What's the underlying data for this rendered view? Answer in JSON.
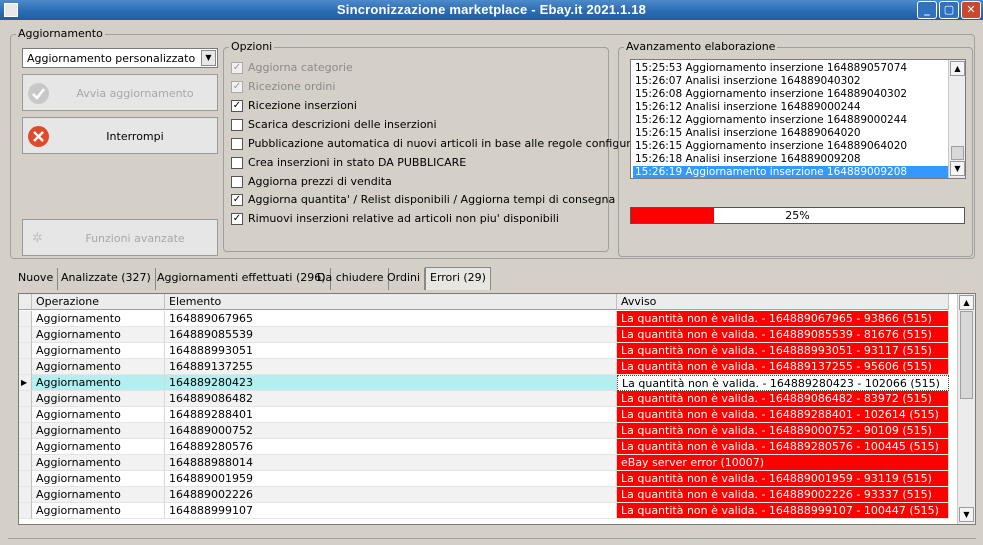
{
  "window": {
    "title": "Sincronizzazione marketplace - Ebay.it 2021.1.18"
  },
  "aggiornamento": {
    "group_label": "Aggiornamento",
    "mode_selected": "Aggiornamento personalizzato",
    "start_button": "Avvia aggiornamento",
    "stop_button": "Interrompi",
    "advanced_button": "Funzioni avanzate"
  },
  "opzioni": {
    "group_label": "Opzioni",
    "items": [
      {
        "label": "Aggiorna categorie",
        "checked": true,
        "enabled": false
      },
      {
        "label": "Ricezione ordini",
        "checked": true,
        "enabled": false
      },
      {
        "label": "Ricezione inserzioni",
        "checked": true,
        "enabled": true
      },
      {
        "label": "Scarica descrizioni delle inserzioni",
        "checked": false,
        "enabled": true
      },
      {
        "label": "Pubblicazione automatica di nuovi articoli in base alle regole configurate",
        "checked": false,
        "enabled": true
      },
      {
        "label": "Crea inserzioni in stato DA PUBBLICARE",
        "checked": false,
        "enabled": true
      },
      {
        "label": "Aggiorna prezzi di vendita",
        "checked": false,
        "enabled": true
      },
      {
        "label": "Aggiorna quantita' / Relist disponibili / Aggiorna tempi di consegna",
        "checked": true,
        "enabled": true
      },
      {
        "label": "Rimuovi inserzioni relative ad articoli non piu' disponibili",
        "checked": true,
        "enabled": true
      }
    ]
  },
  "avanzamento": {
    "group_label": "Avanzamento elaborazione",
    "log": [
      "15:25:53 Aggiornamento inserzione 164889057074",
      "15:26:07 Analisi inserzione 164889040302",
      "15:26:08 Aggiornamento inserzione 164889040302",
      "15:26:12 Analisi inserzione 164889000244",
      "15:26:12 Aggiornamento inserzione 164889000244",
      "15:26:15 Analisi inserzione 164889064020",
      "15:26:15 Aggiornamento inserzione 164889064020",
      "15:26:18 Analisi inserzione 164889009208",
      "15:26:19 Aggiornamento inserzione 164889009208"
    ],
    "selected_index": 8,
    "progress_fraction": 0.25,
    "progress_label": "25%"
  },
  "tabs": [
    "Nuove",
    "Analizzate (327)",
    "Aggiornamenti effettuati (296)",
    "Da chiudere",
    "Ordini",
    "Errori (29)"
  ],
  "active_tab": 5,
  "grid": {
    "headers": [
      "Operazione",
      "Elemento",
      "Avviso"
    ],
    "rows": [
      {
        "op": "Aggiornamento",
        "el": "164889067965",
        "msg": "La quantità non è valida. - 164889067965 - 93866 (515)"
      },
      {
        "op": "Aggiornamento",
        "el": "164889085539",
        "msg": "La quantità non è valida. - 164889085539 - 81676 (515)"
      },
      {
        "op": "Aggiornamento",
        "el": "164888993051",
        "msg": "La quantità non è valida. - 164888993051 - 93117 (515)"
      },
      {
        "op": "Aggiornamento",
        "el": "164889137255",
        "msg": "La quantità non è valida. - 164889137255 - 95606 (515)"
      },
      {
        "op": "Aggiornamento",
        "el": "164889280423",
        "msg": "La quantità non è valida. - 164889280423 - 102066 (515)"
      },
      {
        "op": "Aggiornamento",
        "el": "164889086482",
        "msg": "La quantità non è valida. - 164889086482 - 83972 (515)"
      },
      {
        "op": "Aggiornamento",
        "el": "164889288401",
        "msg": "La quantità non è valida. - 164889288401 - 102614 (515)"
      },
      {
        "op": "Aggiornamento",
        "el": "164889000752",
        "msg": "La quantità non è valida. - 164889000752 - 90109 (515)"
      },
      {
        "op": "Aggiornamento",
        "el": "164889280576",
        "msg": "La quantità non è valida. - 164889280576 - 100445 (515)"
      },
      {
        "op": "Aggiornamento",
        "el": "164888988014",
        "msg": "eBay server error (10007)"
      },
      {
        "op": "Aggiornamento",
        "el": "164889001959",
        "msg": "La quantità non è valida. - 164889001959 - 93119 (515)"
      },
      {
        "op": "Aggiornamento",
        "el": "164889002226",
        "msg": "La quantità non è valida. - 164889002226 - 93337 (515)"
      },
      {
        "op": "Aggiornamento",
        "el": "164888999107",
        "msg": "La quantità non è valida. - 164888999107 - 100447 (515)"
      }
    ],
    "current_row": 4
  },
  "colors": {
    "error": "#ff0000",
    "current_row": "#b3eef0",
    "log_selection": "#3399ff",
    "title_bar": "#2b6cb3"
  },
  "icons": {
    "start": "check-circle-icon",
    "stop": "x-circle-icon",
    "advanced": "gear-icon",
    "row_pointer": "triangle-right-icon"
  }
}
